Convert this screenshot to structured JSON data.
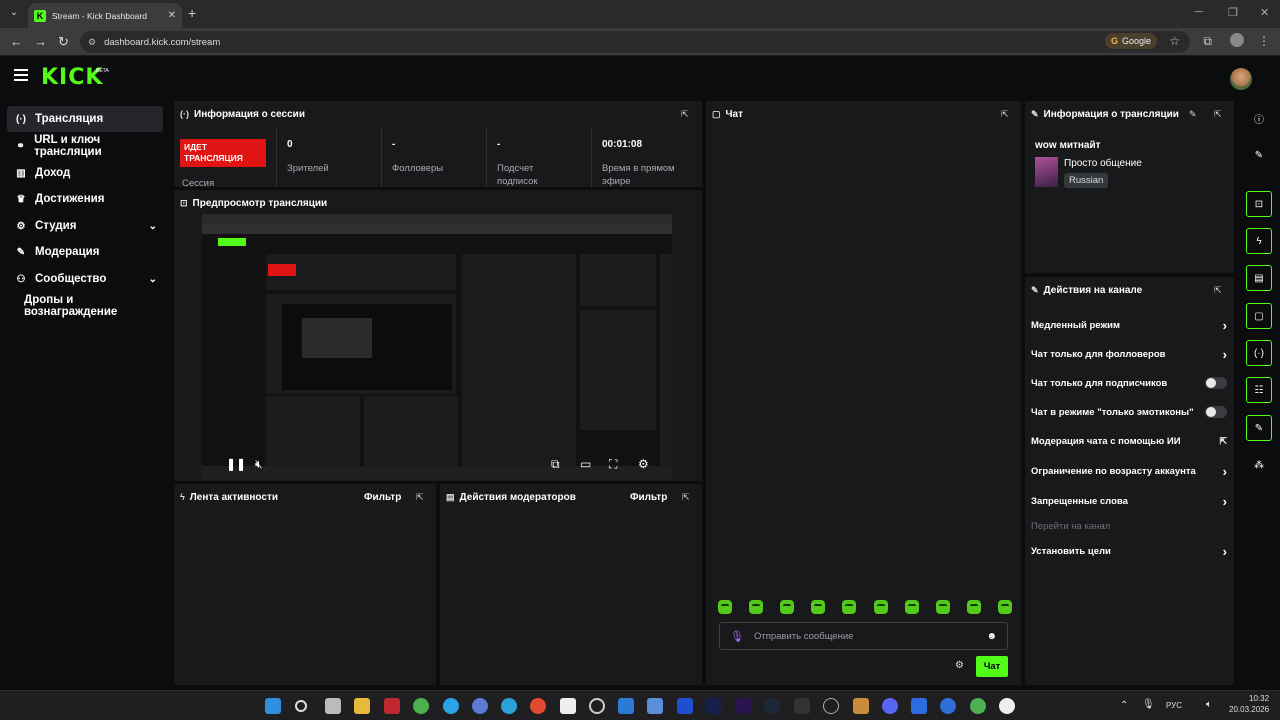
{
  "browser": {
    "tab_title": "Stream - Kick Dashboard",
    "url": "dashboard.kick.com/stream",
    "google_chip": "Google"
  },
  "app": {
    "logo": "KICK",
    "beta": "BETA"
  },
  "sidebar": {
    "items": [
      {
        "label": "Трансляция",
        "icon": "broadcast-icon"
      },
      {
        "label": "URL и ключ трансляции",
        "icon": "link-icon"
      },
      {
        "label": "Доход",
        "icon": "chart-icon"
      },
      {
        "label": "Достижения",
        "icon": "trophy-icon"
      },
      {
        "label": "Студия",
        "icon": "studio-icon"
      },
      {
        "label": "Модерация",
        "icon": "wrench-icon"
      },
      {
        "label": "Сообщество",
        "icon": "people-icon"
      },
      {
        "label": "Дропы и вознаграждение",
        "icon": ""
      }
    ]
  },
  "session": {
    "title": "Информация о сессии",
    "live_badge": "ИДЕТ ТРАНСЛЯЦИЯ",
    "session_label": "Сессия",
    "stats": [
      {
        "value": "0",
        "label": "Зрителей"
      },
      {
        "value": "-",
        "label": "Фолловеры"
      },
      {
        "value": "-",
        "label": "Подсчет подписок"
      },
      {
        "value": "00:01:08",
        "label": "Время в прямом эфире"
      }
    ]
  },
  "preview": {
    "title": "Предпросмотр трансляции"
  },
  "activity": {
    "title": "Лента активности",
    "filter": "Фильтр"
  },
  "mod_actions": {
    "title": "Действия модераторов",
    "filter": "Фильтр"
  },
  "chat": {
    "title": "Чат",
    "placeholder": "Отправить сообщение",
    "send_label": "Чат",
    "emote_count": 10
  },
  "stream_info": {
    "title": "Информация о трансляции",
    "stream_title": "wow митнайт",
    "category": "Просто общение",
    "language": "Russian"
  },
  "channel_actions": {
    "title": "Действия на канале",
    "items": [
      {
        "label": "Медленный режим",
        "control": "chevron"
      },
      {
        "label": "Чат только для фолловеров",
        "control": "chevron"
      },
      {
        "label": "Чат только для подписчиков",
        "control": "toggle"
      },
      {
        "label": "Чат в режиме \"только эмотиконы\"",
        "control": "toggle"
      },
      {
        "label": "Модерация чата с помощью ИИ",
        "control": "external"
      },
      {
        "label": "Ограничение по возрасту аккаунта",
        "control": "chevron"
      },
      {
        "label": "Запрещенные слова",
        "control": "chevron"
      },
      {
        "label": "Перейти на канал",
        "control": "none"
      },
      {
        "label": "Установить цели",
        "control": "chevron"
      }
    ]
  },
  "taskbar": {
    "language": "РУС",
    "time": "10:32",
    "date": "20.03.2026"
  },
  "colors": {
    "accent": "#53fc18",
    "live": "#e11414",
    "panel": "#18191b",
    "background": "#0b0c0d"
  }
}
